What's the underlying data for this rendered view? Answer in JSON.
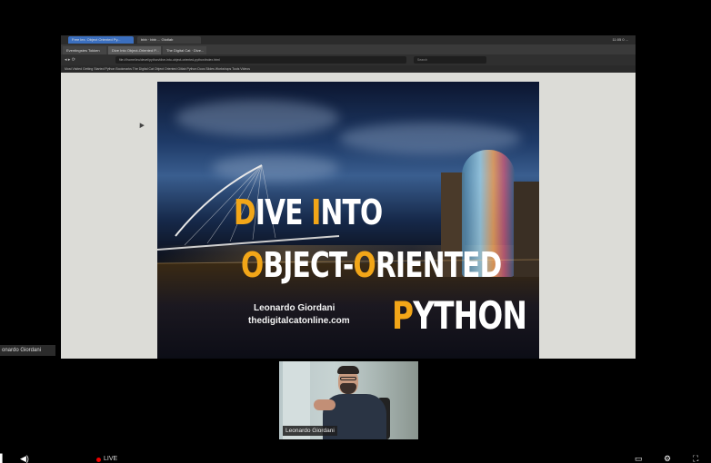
{
  "browser": {
    "tabs_top": [
      "Free lex. Object Oriented Py...",
      "bbb · bbb ... Gtotlab"
    ],
    "tabs": [
      "Eventingstes Tokken",
      "Dive Into Object-Oriented P...",
      "The Digital Cat · Dive..."
    ],
    "clock": "11:05 0 ...",
    "url": "file:///home/leo/devel/python/dive-into-object-oriented-python/index.html",
    "search_placeholder": "Search",
    "bookmarks": "Most Visited  Getting Started  Python  Bookmarks  The Digital Cat  Object Oriented  Gitlab  Python Docs  Slides  Workshops  Tools  Videos"
  },
  "slide": {
    "line1": [
      {
        "cap": "D",
        "rest": "IVE "
      },
      {
        "cap": "I",
        "rest": "NTO"
      }
    ],
    "line2": [
      {
        "cap": "O",
        "rest": "BJECT-"
      },
      {
        "cap": "O",
        "rest": "RIENTED"
      }
    ],
    "line3": [
      {
        "cap": "P",
        "rest": "YTHON"
      }
    ],
    "author": "Leonardo Giordani",
    "site": "thedigitalcatonline.com"
  },
  "presenter_tag": "onardo Giordani",
  "webcam": {
    "name": "Leonardo Giordani"
  },
  "player": {
    "live_label": "LIVE"
  },
  "colors": {
    "accent": "#f2a618",
    "background": "#000000",
    "live": "#e00000"
  }
}
